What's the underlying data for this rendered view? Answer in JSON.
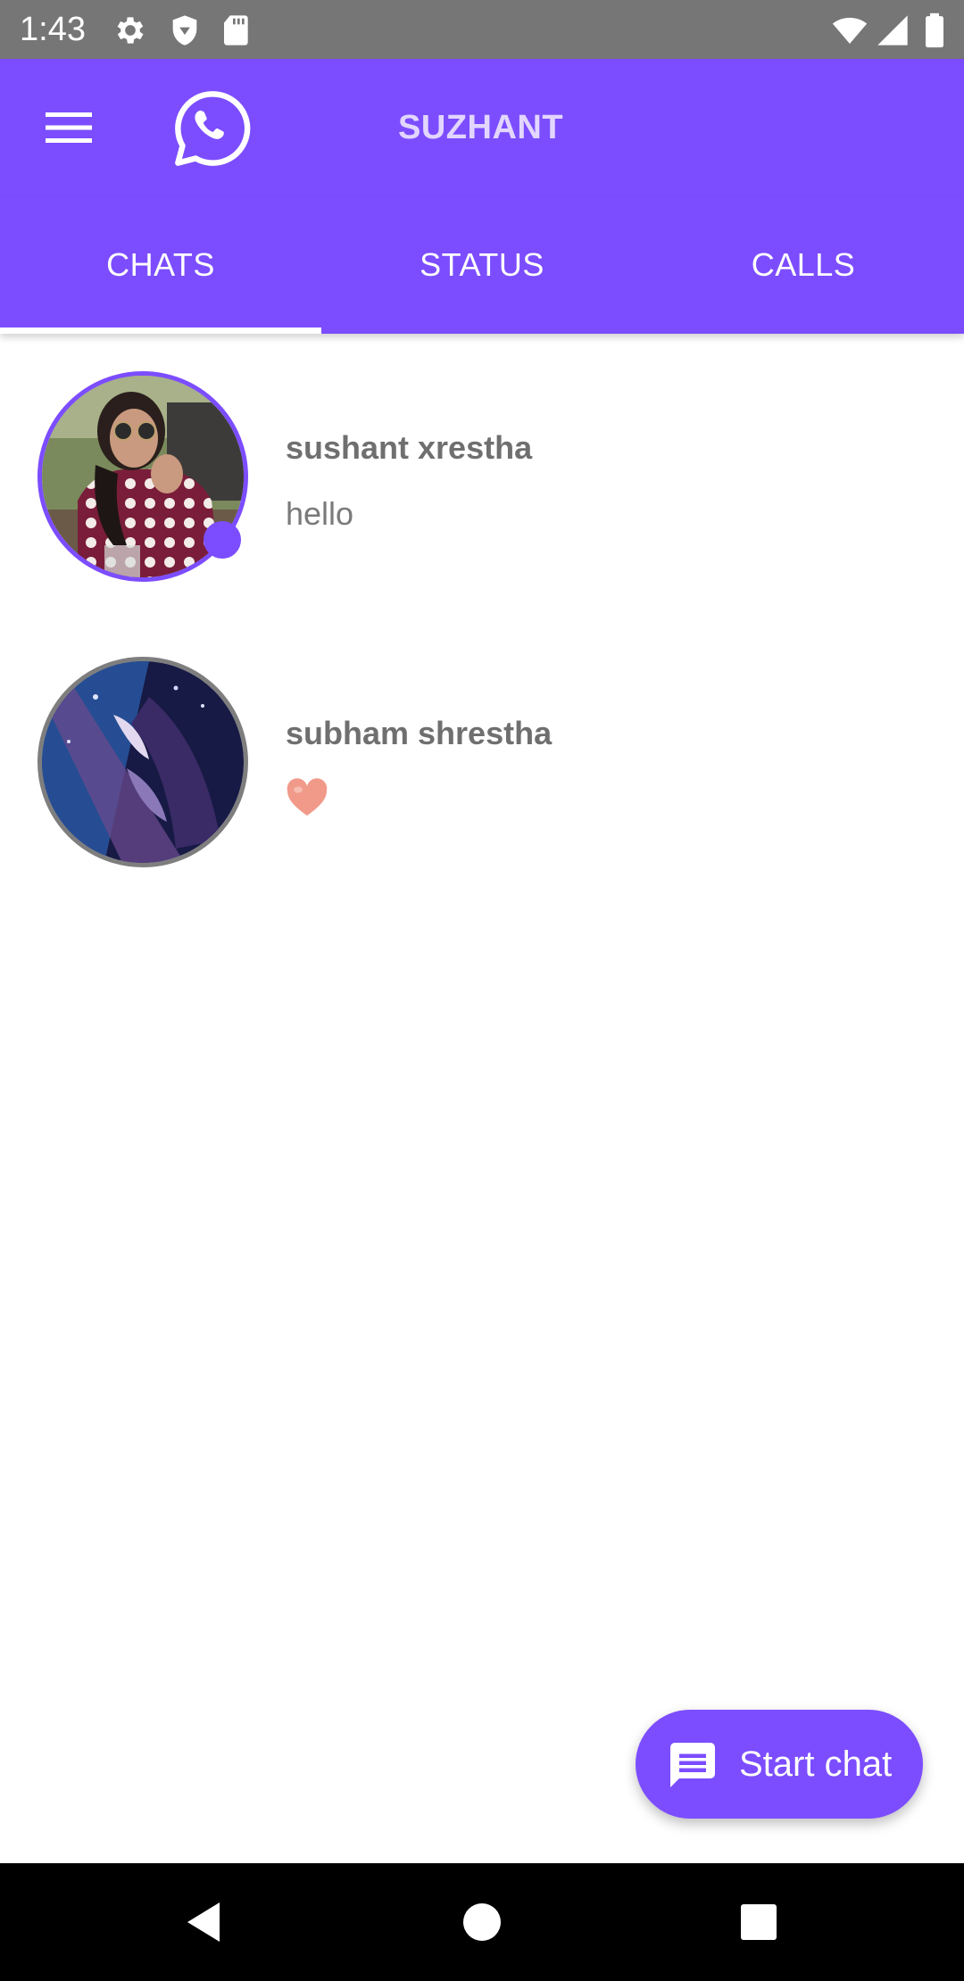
{
  "status_bar": {
    "time": "1:43",
    "icons": [
      "settings-icon",
      "shield-icon",
      "sd-card-icon",
      "wifi-icon",
      "signal-icon",
      "battery-icon"
    ]
  },
  "app_bar": {
    "title": "SUZHANT",
    "icons": [
      "menu-icon",
      "whatsapp-icon"
    ]
  },
  "tabs": [
    {
      "label": "CHATS",
      "selected": true
    },
    {
      "label": "STATUS",
      "selected": false
    },
    {
      "label": "CALLS",
      "selected": false
    }
  ],
  "chats": [
    {
      "name": "sushant xrestha",
      "message": "hello",
      "online": true
    },
    {
      "name": "subham shrestha",
      "message": "",
      "message_icon": "heart-emoji",
      "online": false
    }
  ],
  "fab": {
    "label": "Start chat",
    "icon": "message-icon"
  },
  "nav_bar": {
    "icons": [
      "back-icon",
      "home-icon",
      "recents-icon"
    ]
  },
  "colors": {
    "primary": "#7c4dff",
    "title_text": "#e2d6ff",
    "status_bar": "#767676",
    "nav_bar": "#000000"
  }
}
